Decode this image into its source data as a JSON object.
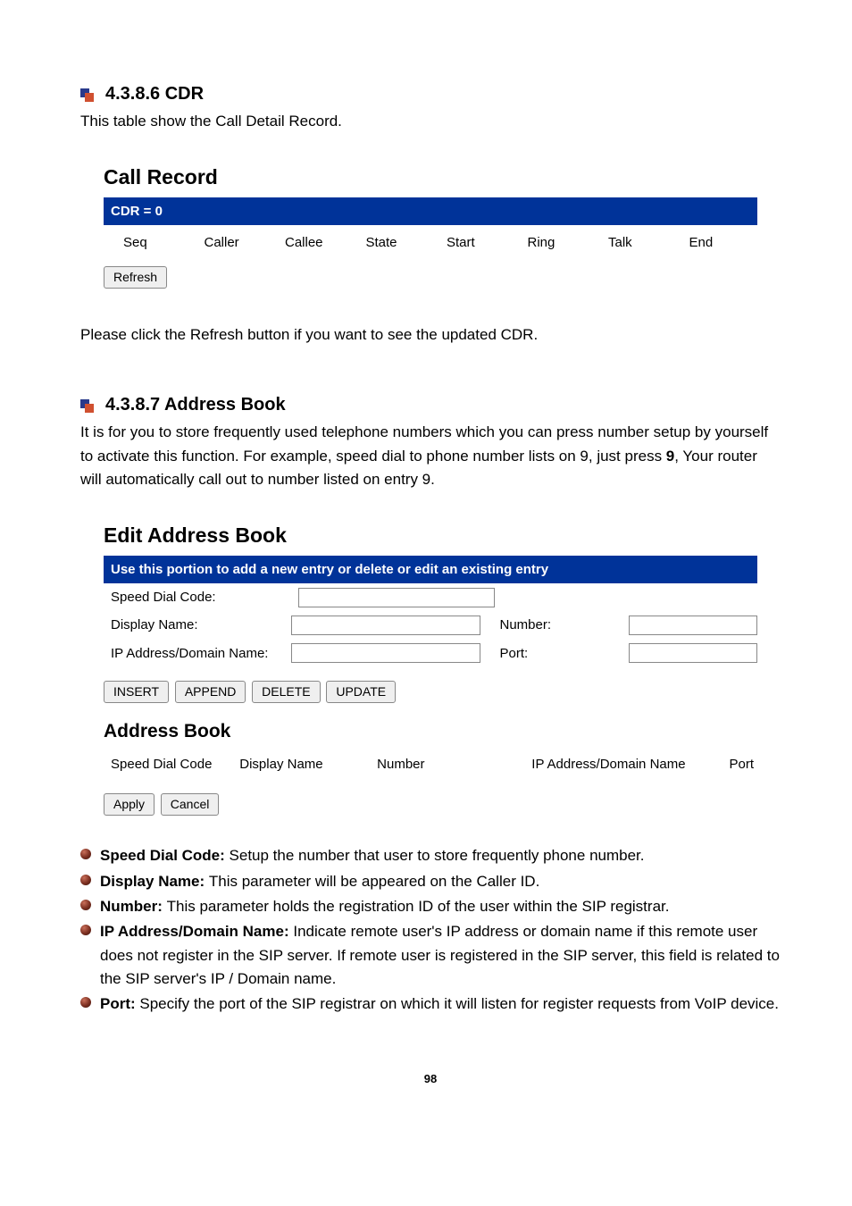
{
  "section_cdr": {
    "heading": "4.3.8.6 CDR",
    "intro": "This table show the Call Detail Record.",
    "note": "Please click the Refresh button if you want to see the updated CDR."
  },
  "call_record": {
    "title": "Call Record",
    "bar": "CDR = 0",
    "cols": [
      "Seq",
      "Caller",
      "Callee",
      "State",
      "Start",
      "Ring",
      "Talk",
      "End"
    ],
    "refresh": "Refresh"
  },
  "section_ab": {
    "heading": "4.3.8.7 Address Book",
    "intro_part1": "It is for you to store frequently used telephone numbers which you can press number setup by yourself to activate this function. For example, speed dial to phone number lists on 9, just press ",
    "intro_bold": "9",
    "intro_part2": ", Your router will automatically call out to number listed on entry 9."
  },
  "edit_ab": {
    "title": "Edit Address Book",
    "bar": "Use this portion to add a new entry or delete or edit an existing entry",
    "lbl_speed": "Speed Dial Code:",
    "lbl_display": "Display Name:",
    "lbl_number": "Number:",
    "lbl_ip": "IP Address/Domain Name:",
    "lbl_port": "Port:",
    "btn_insert": "INSERT",
    "btn_append": "APPEND",
    "btn_delete": "DELETE",
    "btn_update": "UPDATE",
    "subtitle": "Address Book",
    "cols": {
      "c1": "Speed Dial Code",
      "c2": "Display Name",
      "c3": "Number",
      "c4": "IP Address/Domain Name",
      "c5": "Port"
    },
    "btn_apply": "Apply",
    "btn_cancel": "Cancel"
  },
  "bullets": {
    "speed_t": "Speed Dial Code: ",
    "speed": "Setup the number that user to store frequently phone number.",
    "display_t": "Display Name: ",
    "display": "This parameter will be appeared on the Caller ID.",
    "number_t": "Number: ",
    "number": "This parameter holds the registration ID of the user within the SIP registrar.",
    "ip_t": "IP Address/Domain Name: ",
    "ip": "Indicate remote user's IP address or domain name if this remote user does not register in the SIP server. If remote user is registered in the SIP server, this field is related to the SIP server's IP / Domain name.",
    "port_t": "Port: ",
    "port": "Specify the port of the SIP registrar on which it will listen for register requests from VoIP device."
  },
  "page_number": "98"
}
